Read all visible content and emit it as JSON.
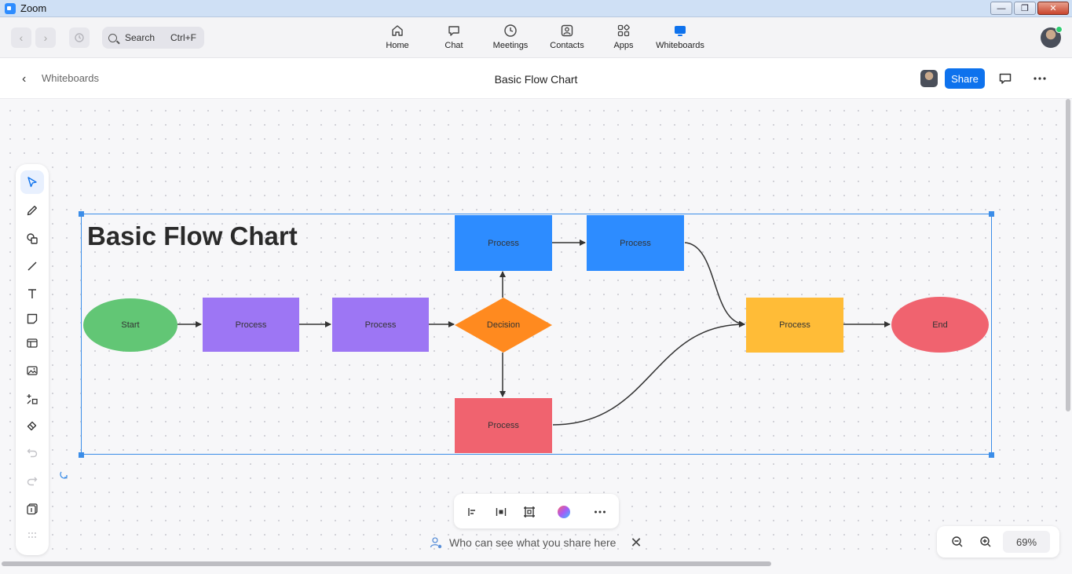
{
  "window": {
    "title": "Zoom",
    "controls": [
      "minimize",
      "restore",
      "close"
    ]
  },
  "topnav": {
    "search_label": "Search",
    "search_shortcut": "Ctrl+F",
    "items": [
      {
        "label": "Home",
        "icon": "home-icon"
      },
      {
        "label": "Chat",
        "icon": "chat-icon"
      },
      {
        "label": "Meetings",
        "icon": "clock-icon"
      },
      {
        "label": "Contacts",
        "icon": "contacts-icon"
      },
      {
        "label": "Apps",
        "icon": "apps-icon"
      },
      {
        "label": "Whiteboards",
        "icon": "whiteboard-icon"
      }
    ],
    "active_item": "Whiteboards"
  },
  "header": {
    "breadcrumb": "Whiteboards",
    "title": "Basic Flow Chart",
    "share_label": "Share"
  },
  "board": {
    "title": "Basic Flow Chart",
    "nodes": {
      "start": "Start",
      "process1": "Process",
      "process2": "Process",
      "decision": "Decision",
      "process_top1": "Process",
      "process_top2": "Process",
      "process_bottom": "Process",
      "process_right": "Process",
      "end": "End"
    }
  },
  "notice": {
    "text": "Who can see what you share here"
  },
  "zoom": {
    "level": "69%"
  },
  "colors": {
    "accent": "#0e72ed",
    "selection": "#3b8de8",
    "start": "#62c675",
    "process_purple": "#9d76f4",
    "decision": "#ff8a1f",
    "process_blue": "#2d8cff",
    "process_red": "#f0636f",
    "process_yellow": "#ffbc37",
    "end": "#f0636f"
  }
}
